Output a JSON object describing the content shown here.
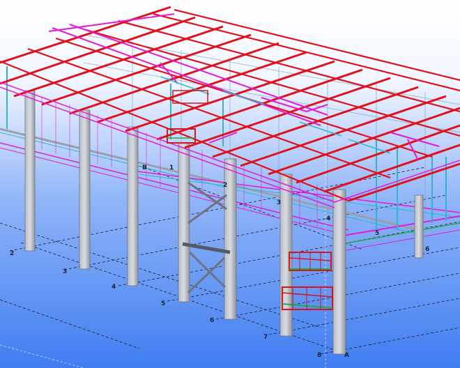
{
  "viewport": {
    "background_top": "#ffffff",
    "background_bottom": "#3f7df0"
  },
  "colors": {
    "rafter": "#e0101c",
    "bracing": "#e11bd6",
    "column": "#9aa0aa",
    "column_edge": "#6e7480",
    "secondary": "#2fb6c9",
    "platform": "#d4151b",
    "platform_green": "#25a84a",
    "grid_line": "#1b1b2a"
  },
  "grid_labels": {
    "front": [
      "2",
      "3",
      "4",
      "5",
      "6",
      "7",
      "8"
    ],
    "corner": "A",
    "back": [
      "1",
      "2",
      "3",
      "4",
      "5",
      "6"
    ],
    "row_b": "B"
  }
}
